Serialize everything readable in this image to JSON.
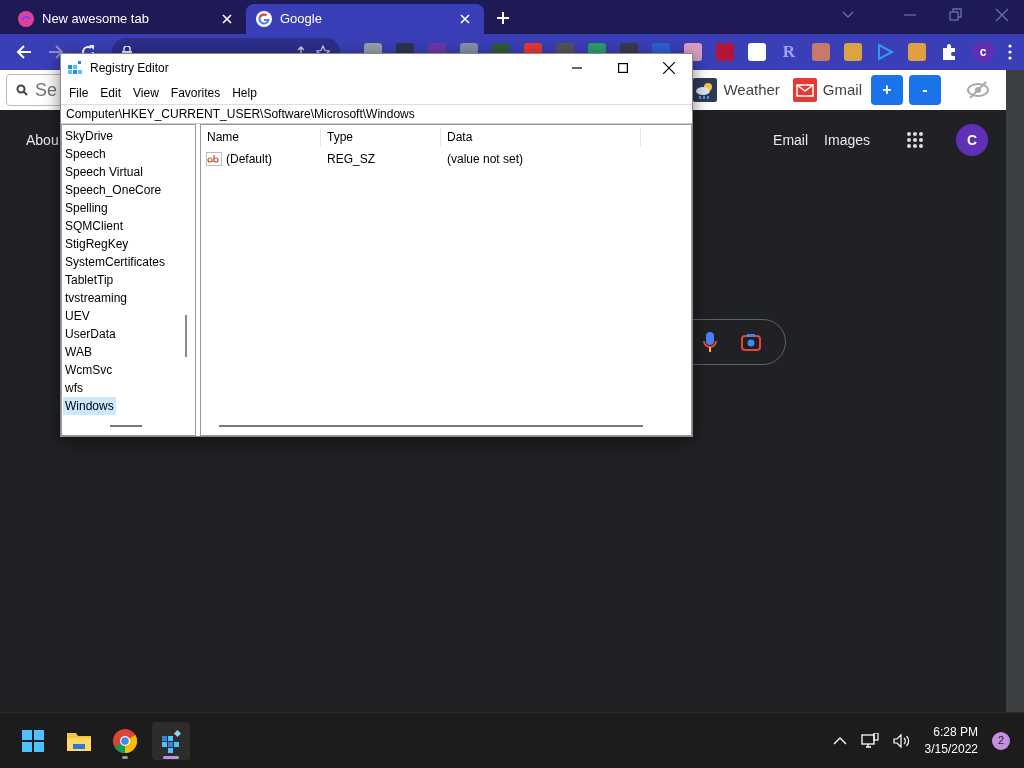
{
  "browser": {
    "tabs": [
      {
        "title": "New awesome tab",
        "selected": false
      },
      {
        "title": "Google",
        "selected": true
      }
    ],
    "extensions": [
      {
        "kind": "square",
        "color": "#9aa0a6"
      },
      {
        "kind": "square",
        "color": "#2f3350"
      },
      {
        "kind": "square",
        "color": "#6a3aa8"
      },
      {
        "kind": "square",
        "color": "#8a8fa6"
      },
      {
        "kind": "square",
        "color": "#2e5a3a"
      },
      {
        "kind": "square",
        "color": "#e53935"
      },
      {
        "kind": "square",
        "color": "#555555"
      },
      {
        "kind": "square",
        "color": "#2f9e6e"
      },
      {
        "kind": "square",
        "color": "#3a3a4a"
      },
      {
        "kind": "square",
        "color": "#2c5fd6"
      },
      {
        "kind": "square",
        "color": "#d9a0c0"
      },
      {
        "kind": "square",
        "color": "#b0163a"
      },
      {
        "kind": "square",
        "color": "#ffffff"
      },
      {
        "kind": "letter",
        "label": "R",
        "color": "#a0a0ff"
      },
      {
        "kind": "square",
        "color": "#c77a6a"
      },
      {
        "kind": "square",
        "color": "#d9a441"
      },
      {
        "kind": "play",
        "color": "#2d9cf0"
      },
      {
        "kind": "square",
        "color": "#e0a040"
      }
    ],
    "profile_initial": "c"
  },
  "extension_bar": {
    "search_placeholder": "Se",
    "links": [
      {
        "kind": "weather",
        "label": "Weather"
      },
      {
        "kind": "mail",
        "label": "Gmail"
      }
    ],
    "buttons": [
      "+",
      "-"
    ]
  },
  "google": {
    "nav_left": "Abou",
    "nav_right": [
      "Email",
      "Images"
    ],
    "avatar": "C"
  },
  "registry_editor": {
    "title": "Registry Editor",
    "menu": [
      "File",
      "Edit",
      "View",
      "Favorites",
      "Help"
    ],
    "path": "Computer\\HKEY_CURRENT_USER\\Software\\Microsoft\\Windows",
    "tree": [
      {
        "label": "SkyDrive",
        "selected": false
      },
      {
        "label": "Speech",
        "selected": false
      },
      {
        "label": "Speech Virtual",
        "selected": false
      },
      {
        "label": "Speech_OneCore",
        "selected": false
      },
      {
        "label": "Spelling",
        "selected": false
      },
      {
        "label": "SQMClient",
        "selected": false
      },
      {
        "label": "StigRegKey",
        "selected": false
      },
      {
        "label": "SystemCertificates",
        "selected": false
      },
      {
        "label": "TabletTip",
        "selected": false
      },
      {
        "label": "tvstreaming",
        "selected": false
      },
      {
        "label": "UEV",
        "selected": false
      },
      {
        "label": "UserData",
        "selected": false
      },
      {
        "label": "WAB",
        "selected": false
      },
      {
        "label": "WcmSvc",
        "selected": false
      },
      {
        "label": "wfs",
        "selected": false
      },
      {
        "label": "Windows",
        "selected": true
      }
    ],
    "columns": [
      "Name",
      "Type",
      "Data"
    ],
    "values": [
      {
        "name": "(Default)",
        "type": "REG_SZ",
        "data": "(value not set)"
      }
    ]
  },
  "taskbar": {
    "apps": [
      {
        "kind": "start",
        "active": false,
        "running": false
      },
      {
        "kind": "explorer",
        "active": false,
        "running": false
      },
      {
        "kind": "chrome",
        "active": false,
        "running": true
      },
      {
        "kind": "regedit",
        "active": true,
        "running": true
      }
    ],
    "time": "6:28 PM",
    "date": "3/15/2022",
    "notifications": "2"
  }
}
